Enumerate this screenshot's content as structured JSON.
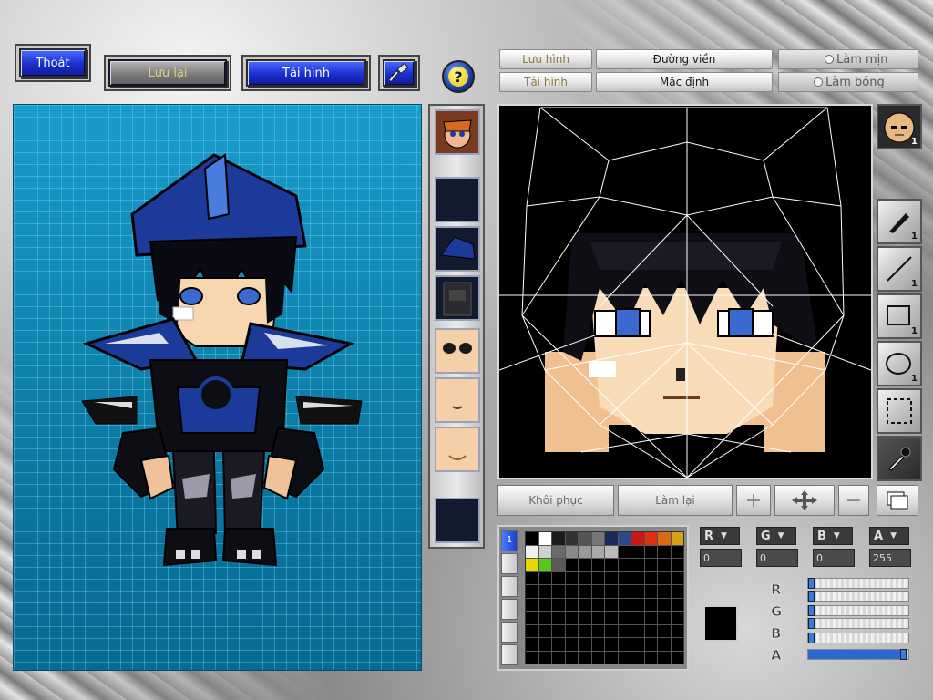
{
  "top_left": {
    "exit_label": "Thoát",
    "save_label": "Lưu lại",
    "reload_label": "Tải hình"
  },
  "help_glyph": "?",
  "top_right": {
    "save_image_label": "Lưu hình",
    "reload_image_label": "Tải hình",
    "outline_label": "Đường viền",
    "default_label": "Mặc định",
    "smooth_label": "Làm mịn",
    "shade_label": "Làm bóng"
  },
  "tools": {
    "brush_count": "1",
    "line_count": "1",
    "rect_count": "1",
    "ellipse_count": "1",
    "face_count": "1"
  },
  "bottom": {
    "restore_label": "Khôi phục",
    "redo_label": "Làm lại",
    "plus_glyph": "+",
    "minus_glyph": "−"
  },
  "palette_tab_label": "1",
  "color": {
    "r_label": "R",
    "g_label": "G",
    "b_label": "B",
    "a_label": "A",
    "r_value": "0",
    "g_value": "0",
    "b_value": "0",
    "a_value": "255",
    "current_color": "#000000",
    "r_level": 0,
    "g_level": 0,
    "b_level": 0,
    "a_level": 1
  },
  "palette_colors": [
    "#000000",
    "#ffffff",
    "#1a1a1a",
    "#333333",
    "#555555",
    "#777777",
    "#1a2a5a",
    "#2a4a8a",
    "#c81818",
    "#e03010",
    "#d86a10",
    "#d8a018",
    "#f0f0f0",
    "#d0d0d0",
    "#6a6a6a",
    "#8a8a8a",
    "#9a9a9a",
    "#aaaaaa",
    "#bbbbbb",
    "#000000",
    "#000000",
    "#000000",
    "#000000",
    "#000000",
    "#e8d800",
    "#58c818",
    "#5a5a5a"
  ]
}
